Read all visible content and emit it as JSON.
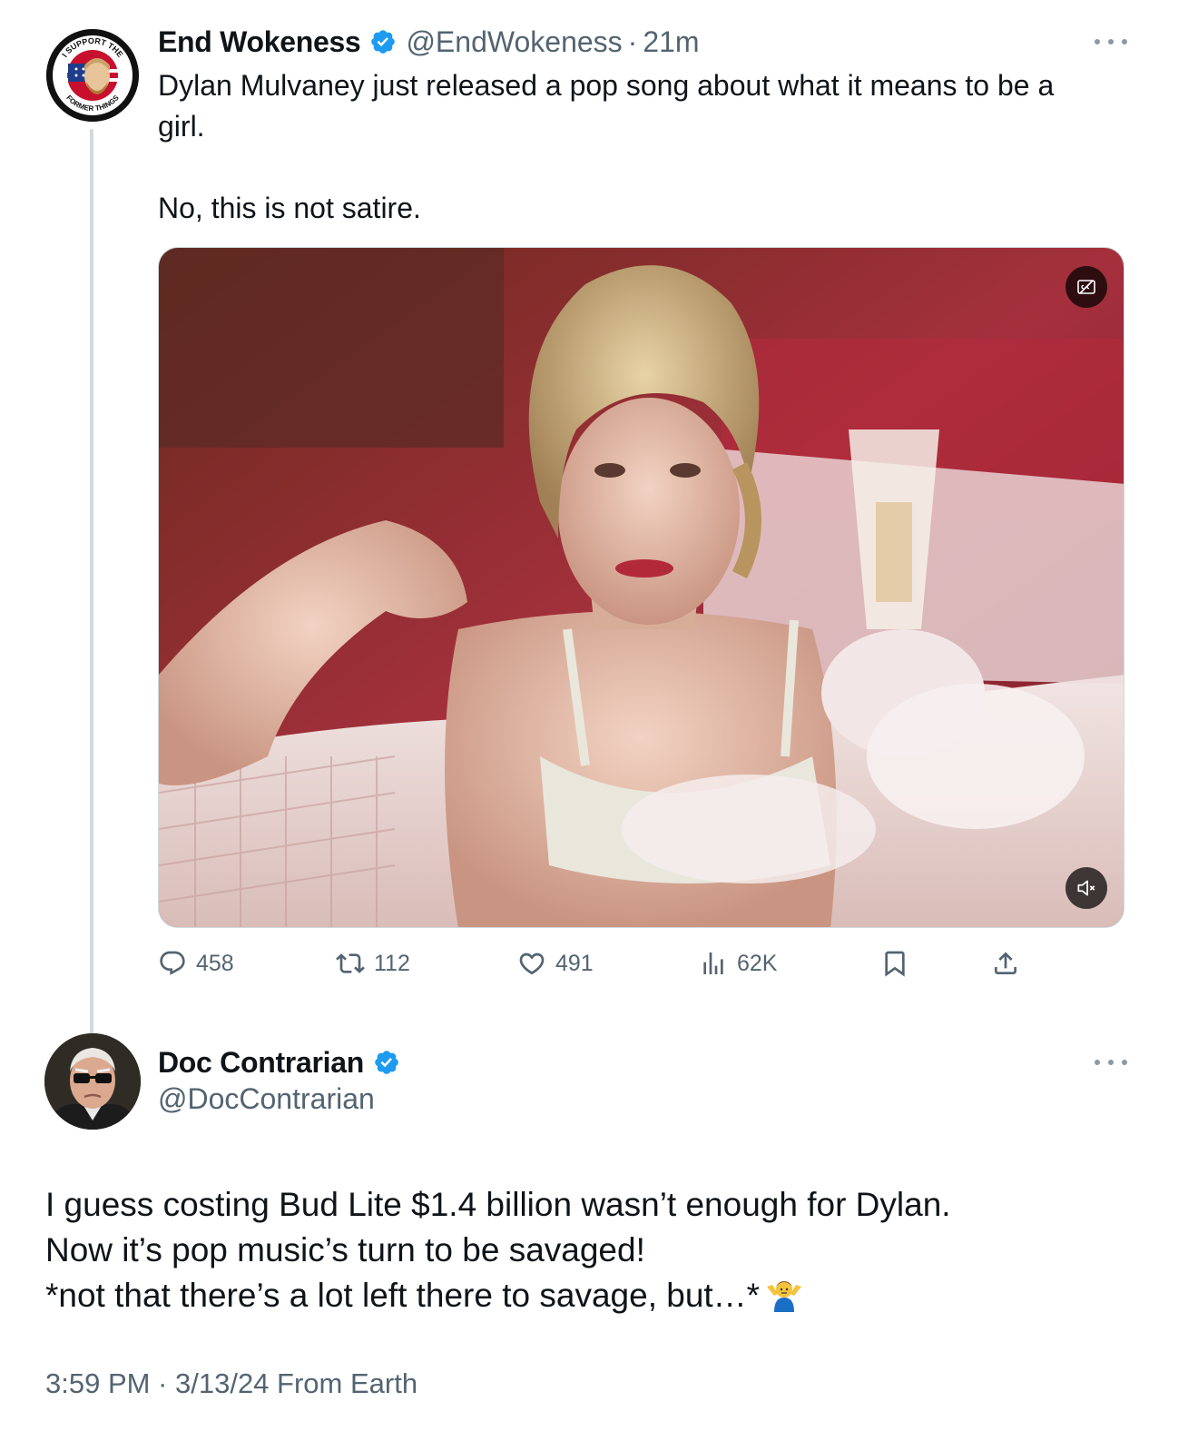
{
  "tweet": {
    "author": {
      "name": "End Wokeness",
      "handle": "@EndWokeness",
      "avatar_text_top": "I SUPPORT THE",
      "avatar_text_bottom": "FORMER THINGS"
    },
    "separator": "·",
    "time": "21m",
    "text_lines": [
      "Dylan Mulvaney just released a pop song about what it means to be a",
      "girl."
    ],
    "text_line2": "No, this is not satire.",
    "stats": {
      "replies": "458",
      "retweets": "112",
      "likes": "491",
      "views": "62K"
    }
  },
  "reply": {
    "author": {
      "name": "Doc Contrarian",
      "handle": "@DocContrarian"
    },
    "text_lines": [
      "I guess costing Bud Lite $1.4 billion wasn’t enough for Dylan.",
      "Now it’s pop music’s turn to be savaged!",
      "*not that there’s a lot left there to savage, but…*"
    ],
    "emoji": "shrug-emoji",
    "meta": "3:59 PM · 3/13/24 From Earth"
  },
  "colors": {
    "text": "#0f1419",
    "secondary": "#536471",
    "verified": "#1d9bf0",
    "thread_line": "#cfd9de"
  }
}
